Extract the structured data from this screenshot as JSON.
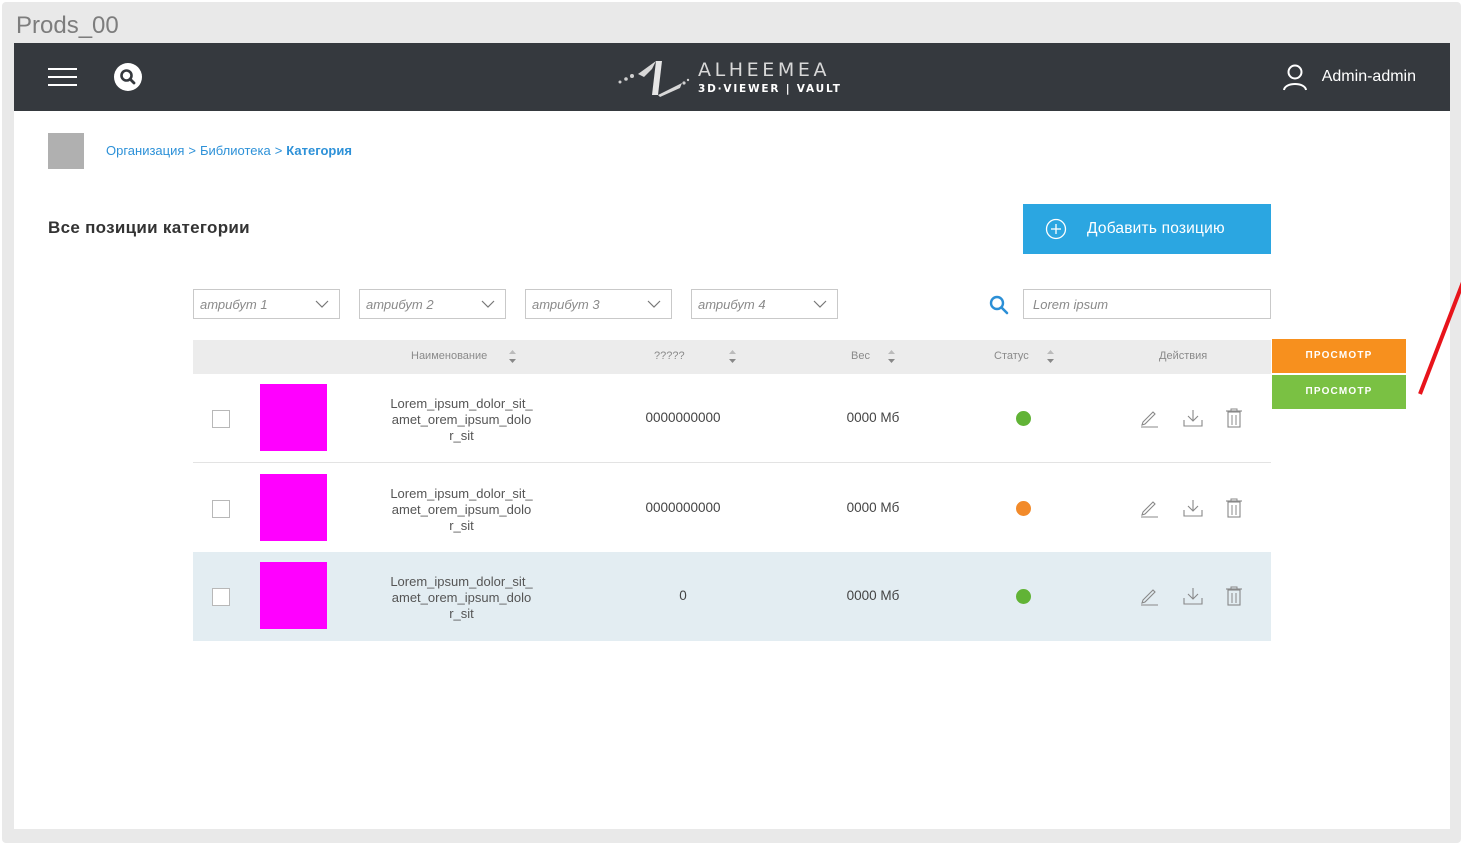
{
  "frame": {
    "title": "Prods_00"
  },
  "header": {
    "logo_name": "ALHEEMEA",
    "logo_sub": "3D·VIEWER | VAULT",
    "user_name": "Admin-admin"
  },
  "breadcrumb": {
    "items": [
      "Организация",
      "Библиотека"
    ],
    "separator": ">",
    "current": "Категория"
  },
  "page": {
    "title": "Все позиции категории",
    "add_button": "Добавить позицию"
  },
  "filters": [
    "атрибут 1",
    "атрибут 2",
    "атрибут 3",
    "атрибут 4"
  ],
  "search": {
    "placeholder": "Lorem ipsum"
  },
  "table": {
    "headers": {
      "name": "Наименование",
      "code": "?????",
      "weight": "Вес",
      "status": "Статус",
      "actions": "Действия"
    },
    "rows": [
      {
        "name_lines": [
          "Lorem_ipsum_dolor_sit_",
          "amet_orem_ipsum_dolo",
          "r_sit"
        ],
        "code": "0000000000",
        "weight": "0000 Мб",
        "status_color": "#61b336"
      },
      {
        "name_lines": [
          "Lorem_ipsum_dolor_sit_",
          "amet_orem_ipsum_dolo",
          "r_sit"
        ],
        "code": "0000000000",
        "weight": "0000 Мб",
        "status_color": "#f28a2a"
      },
      {
        "name_lines": [
          "Lorem_ipsum_dolor_sit_",
          "amet_orem_ipsum_dolo",
          "r_sit"
        ],
        "code": "0",
        "weight": "0000 Мб",
        "status_color": "#61b336"
      }
    ]
  },
  "view_buttons": [
    {
      "label": "ПРОСМОТР",
      "color": "#f7901e"
    },
    {
      "label": "ПРОСМОТР",
      "color": "#7ac143"
    }
  ],
  "colors": {
    "header_bg": "#35393e",
    "accent": "#2ba6e1",
    "thumbnail": "#ff00ff",
    "highlight_row": "#e3edf2",
    "annotation": "#e8141b"
  }
}
